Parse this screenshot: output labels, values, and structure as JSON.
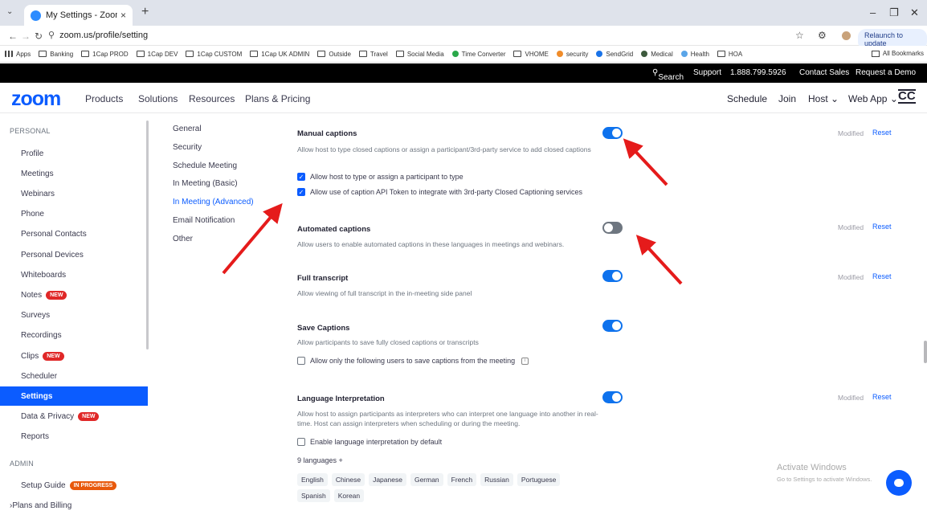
{
  "browser": {
    "tab_title": "My Settings - Zoom",
    "tab_close": "×",
    "new_tab": "+",
    "url": "zoom.us/profile/setting",
    "relaunch": "Relaunch to update",
    "bookmarks": [
      {
        "label": "Apps",
        "icon": "grid"
      },
      {
        "label": "Banking",
        "icon": "folder"
      },
      {
        "label": "1Cap PROD",
        "icon": "folder"
      },
      {
        "label": "1Cap DEV",
        "icon": "folder"
      },
      {
        "label": "1Cap CUSTOM",
        "icon": "folder"
      },
      {
        "label": "1Cap UK ADMIN",
        "icon": "folder"
      },
      {
        "label": "Outside",
        "icon": "folder"
      },
      {
        "label": "Travel",
        "icon": "folder"
      },
      {
        "label": "Social Media",
        "icon": "folder"
      },
      {
        "label": "Time Converter",
        "icon": "dot-green"
      },
      {
        "label": "VHOME",
        "icon": "folder"
      },
      {
        "label": "security",
        "icon": "dot-orange"
      },
      {
        "label": "SendGrid",
        "icon": "dot-blue"
      },
      {
        "label": "Medical",
        "icon": "dot-dark"
      },
      {
        "label": "Health",
        "icon": "dot-lightblue"
      },
      {
        "label": "HOA",
        "icon": "folder"
      }
    ],
    "all_bookmarks": "All Bookmarks"
  },
  "topbar": {
    "search": "Search",
    "support": "Support",
    "phone": "1.888.799.5926",
    "contact_sales": "Contact Sales",
    "request_demo": "Request a Demo"
  },
  "nav": {
    "logo": "zoom",
    "products": "Products",
    "solutions": "Solutions",
    "resources": "Resources",
    "plans": "Plans & Pricing",
    "schedule": "Schedule",
    "join": "Join",
    "host": "Host ⌄",
    "webapp": "Web App ⌄",
    "cc": "CC"
  },
  "sidebar": {
    "personal_label": "PERSONAL",
    "admin_label": "ADMIN",
    "items": [
      {
        "label": "Profile"
      },
      {
        "label": "Meetings"
      },
      {
        "label": "Webinars"
      },
      {
        "label": "Phone"
      },
      {
        "label": "Personal Contacts"
      },
      {
        "label": "Personal Devices"
      },
      {
        "label": "Whiteboards"
      },
      {
        "label": "Notes",
        "badge": "NEW"
      },
      {
        "label": "Surveys"
      },
      {
        "label": "Recordings"
      },
      {
        "label": "Clips",
        "badge": "NEW"
      },
      {
        "label": "Scheduler"
      },
      {
        "label": "Settings"
      },
      {
        "label": "Data & Privacy",
        "badge": "NEW"
      },
      {
        "label": "Reports"
      }
    ],
    "admin_items": [
      {
        "label": "Setup Guide",
        "badge": "IN PROGRESS"
      },
      {
        "label": "Plans and Billing"
      }
    ]
  },
  "submenu": {
    "items": [
      "General",
      "Security",
      "Schedule Meeting",
      "In Meeting (Basic)",
      "In Meeting (Advanced)",
      "Email Notification",
      "Other"
    ],
    "active": "In Meeting (Advanced)"
  },
  "settings": {
    "modified": "Modified",
    "reset": "Reset",
    "manual_captions": {
      "title": "Manual captions",
      "desc": "Allow host to type closed captions or assign a participant/3rd-party service to add closed captions",
      "enabled": true,
      "options": [
        {
          "label": "Allow host to type or assign a participant to type",
          "checked": true
        },
        {
          "label": "Allow use of caption API Token to integrate with 3rd-party Closed Captioning services",
          "checked": true
        }
      ]
    },
    "automated_captions": {
      "title": "Automated captions",
      "desc": "Allow users to enable automated captions in these languages in meetings and webinars.",
      "enabled": false
    },
    "full_transcript": {
      "title": "Full transcript",
      "desc": "Allow viewing of full transcript in the in-meeting side panel",
      "enabled": true
    },
    "save_captions": {
      "title": "Save Captions",
      "desc": "Allow participants to save fully closed captions or transcripts",
      "enabled": true,
      "option": "Allow only the following users to save captions from the meeting"
    },
    "language_interpretation": {
      "title": "Language Interpretation",
      "desc": "Allow host to assign participants as interpreters who can interpret one language into another in real-time. Host can assign interpreters when scheduling or during the meeting.",
      "enabled": true,
      "option": "Enable language interpretation by default",
      "languages_count": "9 languages  +",
      "languages": [
        "English",
        "Chinese",
        "Japanese",
        "German",
        "French",
        "Russian",
        "Portuguese",
        "Spanish",
        "Korean"
      ]
    }
  },
  "watermark": {
    "line1": "Activate Windows",
    "line2": "Go to Settings to activate Windows."
  },
  "colors": {
    "accent": "#0b5cff",
    "toggle_on": "#0e72ed",
    "arrow": "#e51b1b"
  }
}
